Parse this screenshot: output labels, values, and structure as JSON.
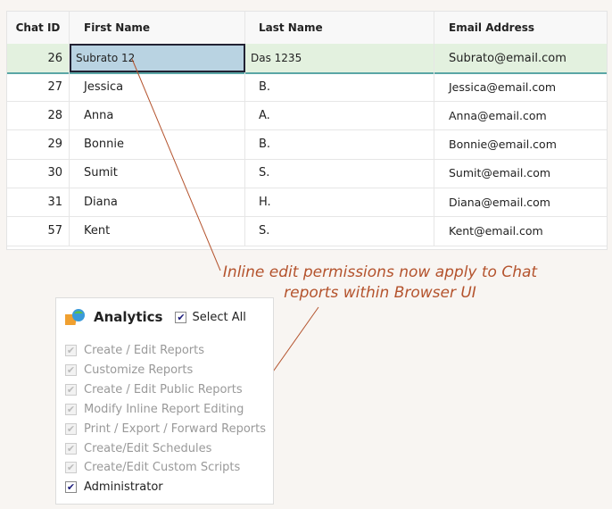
{
  "table": {
    "headers": [
      "Chat ID",
      "First Name",
      "Last Name",
      "Email Address"
    ],
    "editing_row": {
      "id": "26",
      "first": "Subrato 12",
      "last": "Das 1235",
      "email": "Subrato@email.com"
    },
    "rows": [
      {
        "id": "27",
        "first": "Jessica",
        "last": "B.",
        "email": "Jessica@email.com"
      },
      {
        "id": "28",
        "first": "Anna",
        "last": "A.",
        "email": "Anna@email.com"
      },
      {
        "id": "29",
        "first": "Bonnie",
        "last": "B.",
        "email": "Bonnie@email.com"
      },
      {
        "id": "30",
        "first": "Sumit",
        "last": "S.",
        "email": "Sumit@email.com"
      },
      {
        "id": "31",
        "first": "Diana",
        "last": "H.",
        "email": "Diana@email.com"
      },
      {
        "id": "57",
        "first": "Kent",
        "last": "S.",
        "email": "Kent@email.com"
      }
    ]
  },
  "annotation": {
    "line1": "Inline edit permissions now apply to Chat",
    "line2": "reports within Browser UI"
  },
  "panel": {
    "title": "Analytics",
    "select_all": "Select All",
    "items": [
      "Create / Edit Reports",
      "Customize Reports",
      "Create / Edit Public Reports",
      "Modify Inline Report Editing",
      "Print / Export / Forward Reports",
      "Create/Edit Schedules",
      "Create/Edit Custom Scripts",
      "Administrator"
    ]
  }
}
